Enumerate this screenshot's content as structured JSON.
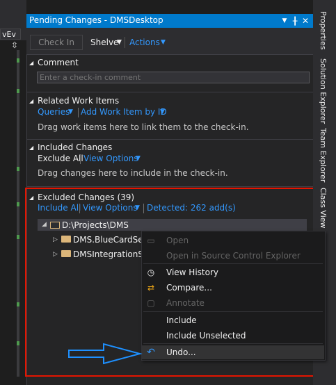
{
  "left": {
    "dropdown_text": "vEv"
  },
  "panel": {
    "title": "Pending Changes - DMSDesktop",
    "title_buttons": [
      "chevron-down-icon",
      "pin-icon",
      "close-icon"
    ]
  },
  "toolbar": {
    "checkin": "Check In",
    "shelve": "Shelve",
    "actions": "Actions"
  },
  "comment": {
    "title": "Comment",
    "placeholder": "Enter a check-in comment"
  },
  "related": {
    "title": "Related Work Items",
    "queries": "Queries",
    "add_by_id": "Add Work Item by ID",
    "hint": "Drag work items here to link them to the check-in."
  },
  "included": {
    "title": "Included Changes",
    "exclude_all": "Exclude All",
    "view_options": "View Options",
    "hint": "Drag changes here to include in the check-in."
  },
  "excluded": {
    "title": "Excluded Changes (39)",
    "include_all": "Include All",
    "view_options": "View Options",
    "detected": "Detected: 262 add(s)",
    "tree": {
      "root": "D:\\Projects\\DMS",
      "children": [
        "DMS.BlueCardServ",
        "DMSIntegrationSer"
      ]
    }
  },
  "right_tabs": [
    "Properties",
    "Solution Explorer",
    "Team Explorer",
    "Class View"
  ],
  "context_menu": {
    "items": [
      {
        "label": "Open",
        "enabled": false,
        "icon": "open-file-icon"
      },
      {
        "label": "Open in Source Control Explorer",
        "enabled": false,
        "icon": ""
      },
      {
        "label": "View History",
        "enabled": true,
        "icon": "history-icon"
      },
      {
        "label": "Compare...",
        "enabled": true,
        "icon": "compare-icon"
      },
      {
        "label": "Annotate",
        "enabled": false,
        "icon": "annotate-icon"
      },
      {
        "label": "Include",
        "enabled": true,
        "icon": ""
      },
      {
        "label": "Include Unselected",
        "enabled": true,
        "icon": ""
      },
      {
        "label": "Undo...",
        "enabled": true,
        "icon": "undo-icon"
      }
    ]
  },
  "colors": {
    "accent": "#007acc",
    "link": "#3399ff",
    "highlight_border": "#e51400",
    "annotation_arrow": "#1e90ff"
  }
}
